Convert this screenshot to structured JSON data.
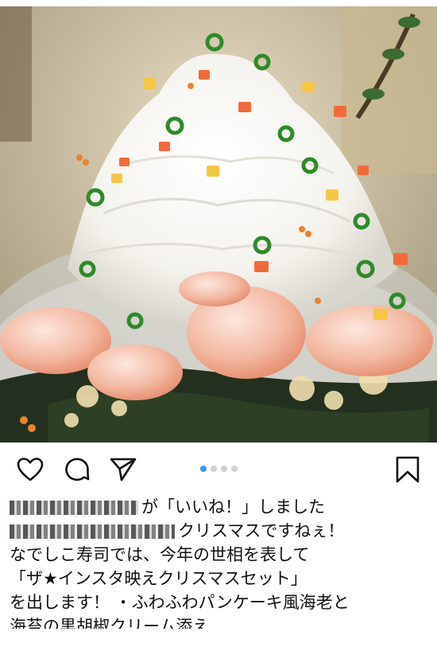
{
  "post": {
    "image_alt": "Food photo",
    "liked_by": {
      "suffix": "が「いいね！」しました"
    },
    "carousel": {
      "total": 4,
      "active_index": 0
    },
    "caption": {
      "line1_suffix": "クリスマスですねぇ！",
      "line2": "なでしこ寿司では、今年の世相を表して",
      "line3": "「ザ★インスタ映えクリスマスセット」",
      "line4": "を出します！ ・ふわふわパンケーキ風海老と",
      "line5": "海苔の黒胡椒クリーム添え"
    }
  },
  "icons": {
    "like": "heart-icon",
    "comment": "comment-bubble-icon",
    "share": "send-arrow-icon",
    "save": "bookmark-icon"
  },
  "colors": {
    "accent": "#3897f0",
    "dot_inactive": "#cfcfcf",
    "text": "#111111"
  }
}
